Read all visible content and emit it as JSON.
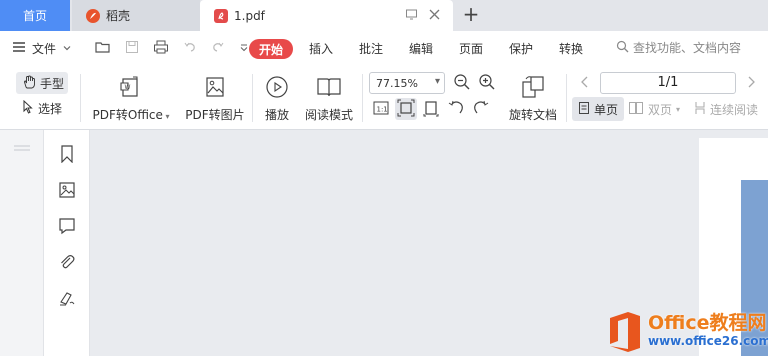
{
  "tabs": {
    "home": "首页",
    "daoke": "稻壳",
    "pdf": "1.pdf",
    "add": "+"
  },
  "menubar": {
    "file": "文件",
    "tabs": [
      "开始",
      "插入",
      "批注",
      "编辑",
      "页面",
      "保护",
      "转换"
    ],
    "search_placeholder": "查找功能、文档内容"
  },
  "ribbon": {
    "hand": "手型",
    "select": "选择",
    "pdf_to_office": "PDF转Office",
    "pdf_to_image": "PDF转图片",
    "play": "播放",
    "read_mode": "阅读模式",
    "zoom": "77.15%",
    "rotate_doc": "旋转文档",
    "page_indicator": "1/1",
    "single_page": "单页",
    "double_page": "双页",
    "continuous_read": "连续阅读"
  },
  "watermark": {
    "line1": "Office教程网",
    "line2": "www.office26.com"
  },
  "colors": {
    "accent": "#4f8df5",
    "start_tab": "#e84a4a",
    "page_image": "#7da2d2",
    "watermark_orange": "#ee7e1d",
    "watermark_blue": "#2a6fd1"
  }
}
